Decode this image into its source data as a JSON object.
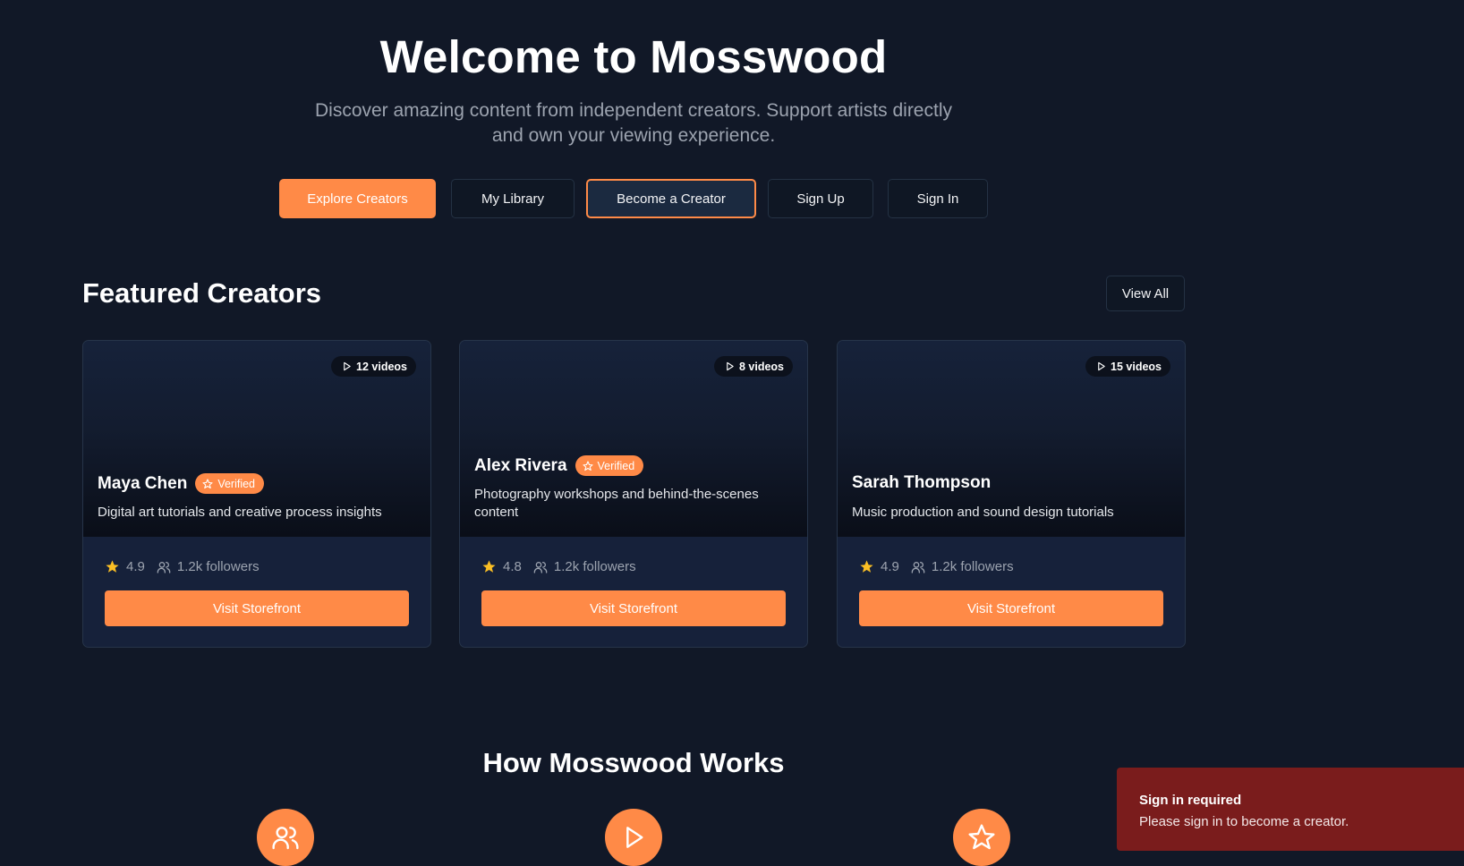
{
  "hero": {
    "title": "Welcome to Mosswood",
    "subtitle": "Discover amazing content from independent creators. Support artists directly and own your viewing experience.",
    "buttons": {
      "explore": "Explore Creators",
      "library": "My Library",
      "become": "Become a Creator",
      "signup": "Sign Up",
      "signin": "Sign In"
    }
  },
  "featured": {
    "title": "Featured Creators",
    "view_all": "View All"
  },
  "creators": [
    {
      "videos": "12 videos",
      "name": "Maya Chen",
      "verified": "Verified",
      "description": "Digital art tutorials and creative process insights",
      "rating": "4.9",
      "followers": "1.2k followers",
      "cta": "Visit Storefront"
    },
    {
      "videos": "8 videos",
      "name": "Alex Rivera",
      "verified": "Verified",
      "description": "Photography workshops and behind-the-scenes content",
      "rating": "4.8",
      "followers": "1.2k followers",
      "cta": "Visit Storefront"
    },
    {
      "videos": "15 videos",
      "name": "Sarah Thompson",
      "verified": "",
      "description": "Music production and sound design tutorials",
      "rating": "4.9",
      "followers": "1.2k followers",
      "cta": "Visit Storefront"
    }
  ],
  "how": {
    "title": "How Mosswood Works",
    "step_icons": [
      "users-icon",
      "play-icon",
      "star-icon"
    ]
  },
  "toast": {
    "title": "Sign in required",
    "message": "Please sign in to become a creator."
  },
  "colors": {
    "background": "#111827",
    "accent": "#ff8a47",
    "card": "#16213a",
    "toast": "#7a1c1c",
    "rating_star": "#fbbf24"
  }
}
